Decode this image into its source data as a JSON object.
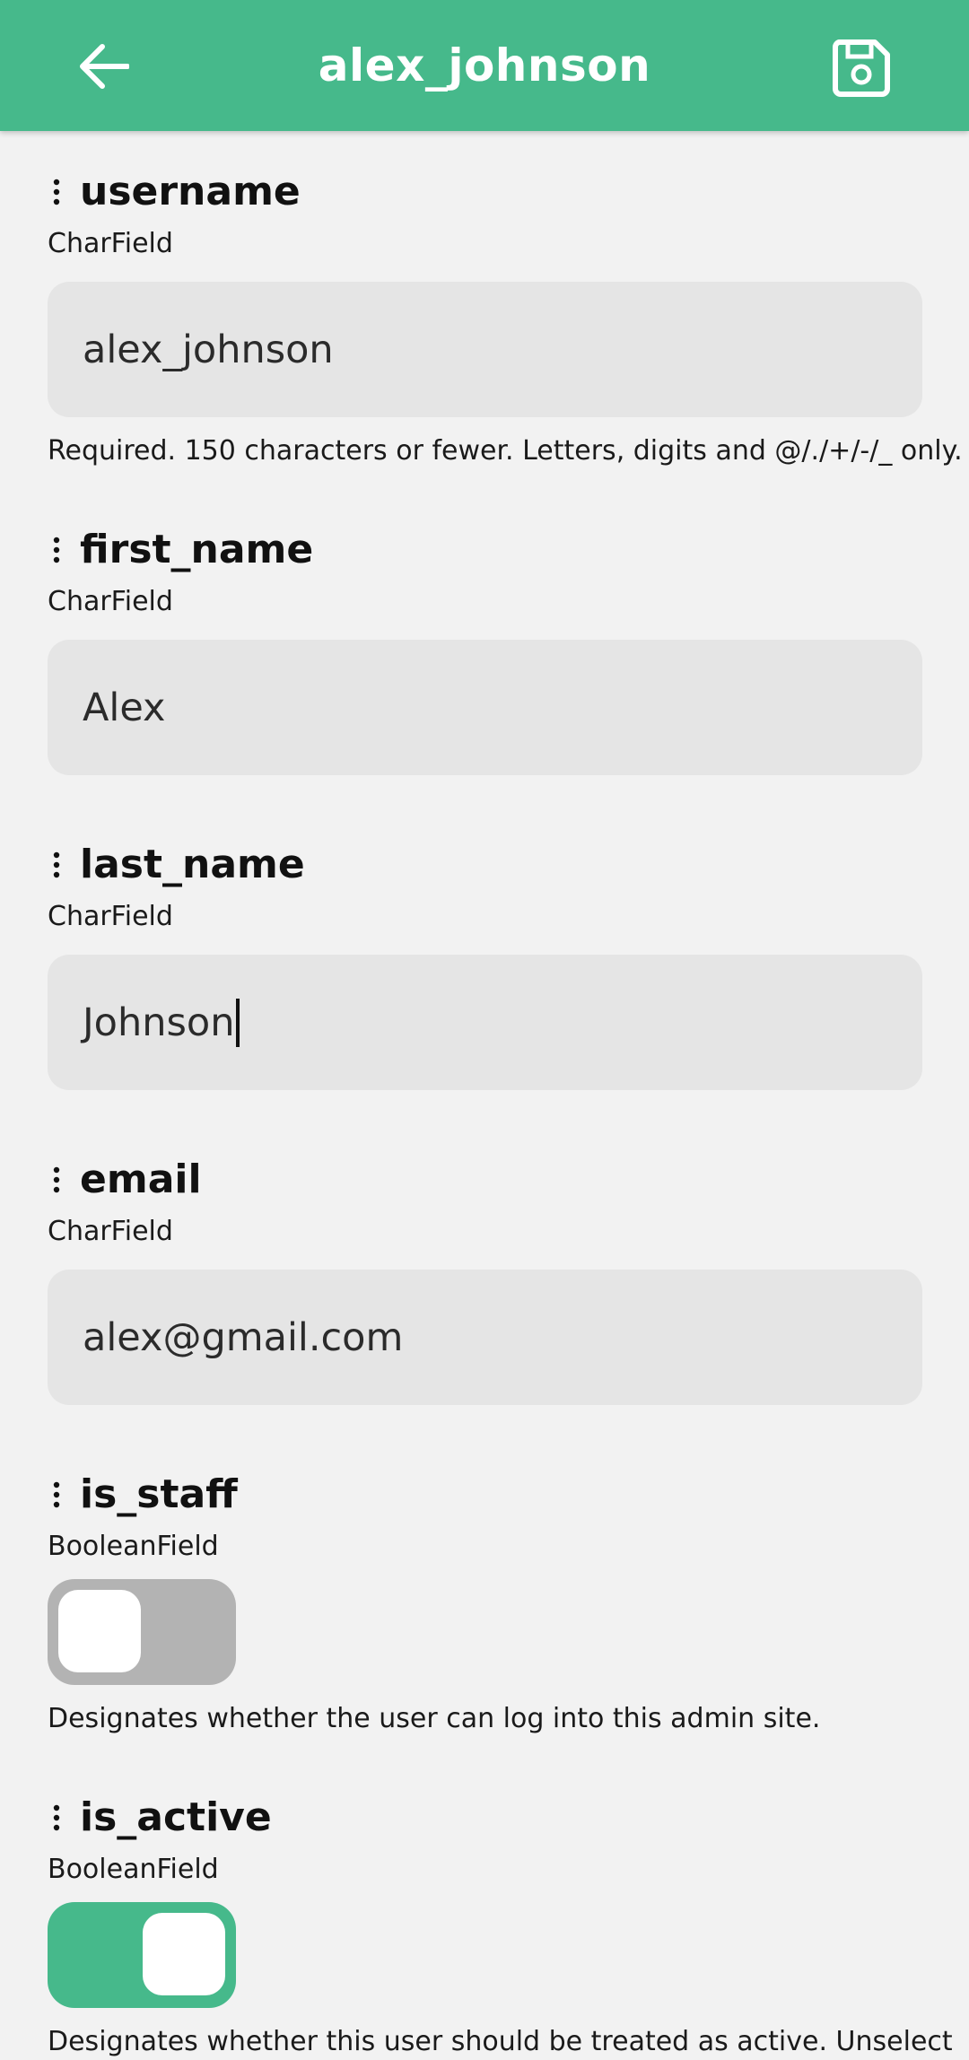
{
  "colors": {
    "accent": "#46b98b",
    "toggle_off": "#b3b3b3",
    "input_bg": "#e5e5e5",
    "page_bg": "#f2f2f2"
  },
  "header": {
    "title": "alex_johnson",
    "back_icon": "arrow-left-icon",
    "save_icon": "floppy-disk-icon"
  },
  "fields": {
    "username": {
      "name": "username",
      "type": "CharField",
      "value": "alex_johnson",
      "help": "Required. 150 characters or fewer. Letters, digits and @/./+/-/_ only."
    },
    "first_name": {
      "name": "first_name",
      "type": "CharField",
      "value": "Alex"
    },
    "last_name": {
      "name": "last_name",
      "type": "CharField",
      "value": "Johnson",
      "focused": true
    },
    "email": {
      "name": "email",
      "type": "CharField",
      "value": "alex@gmail.com"
    },
    "is_staff": {
      "name": "is_staff",
      "type": "BooleanField",
      "checked": false,
      "help": "Designates whether the user can log into this admin site."
    },
    "is_active": {
      "name": "is_active",
      "type": "BooleanField",
      "checked": true,
      "help": "Designates whether this user should be treated as active. Unselect"
    }
  }
}
